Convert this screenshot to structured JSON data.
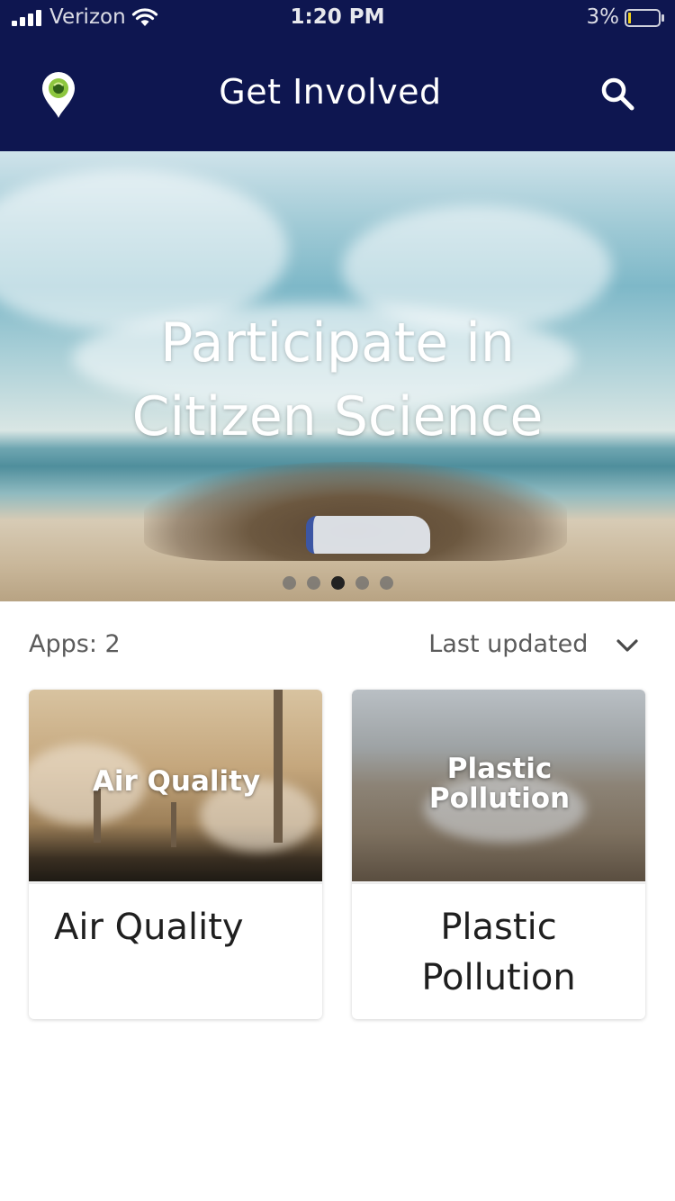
{
  "status_bar": {
    "carrier": "Verizon",
    "time": "1:20 PM",
    "battery_percent": "3%",
    "icons": [
      "signal-icon",
      "wifi-icon",
      "battery-icon"
    ]
  },
  "header": {
    "title": "Get Involved",
    "logo_icon": "location-pin-logo-icon",
    "search_icon": "search-icon"
  },
  "hero": {
    "headline_line1": "Participate in",
    "headline_line2": "Citizen Science",
    "slides_count": 5,
    "active_slide": 3
  },
  "list": {
    "count_label": "Apps: 2",
    "sort_label": "Last updated",
    "sort_icon": "chevron-down-icon"
  },
  "apps": [
    {
      "thumbnail_text": "Air Quality",
      "title": "Air Quality"
    },
    {
      "thumbnail_text_line1": "Plastic",
      "thumbnail_text_line2": "Pollution",
      "title_line1": "Plastic",
      "title_line2": "Pollution"
    }
  ],
  "colors": {
    "header_bg": "#0e1650",
    "text_primary": "#1f1f1f",
    "text_secondary": "#5b5b5b",
    "dot_active": "#222222"
  }
}
